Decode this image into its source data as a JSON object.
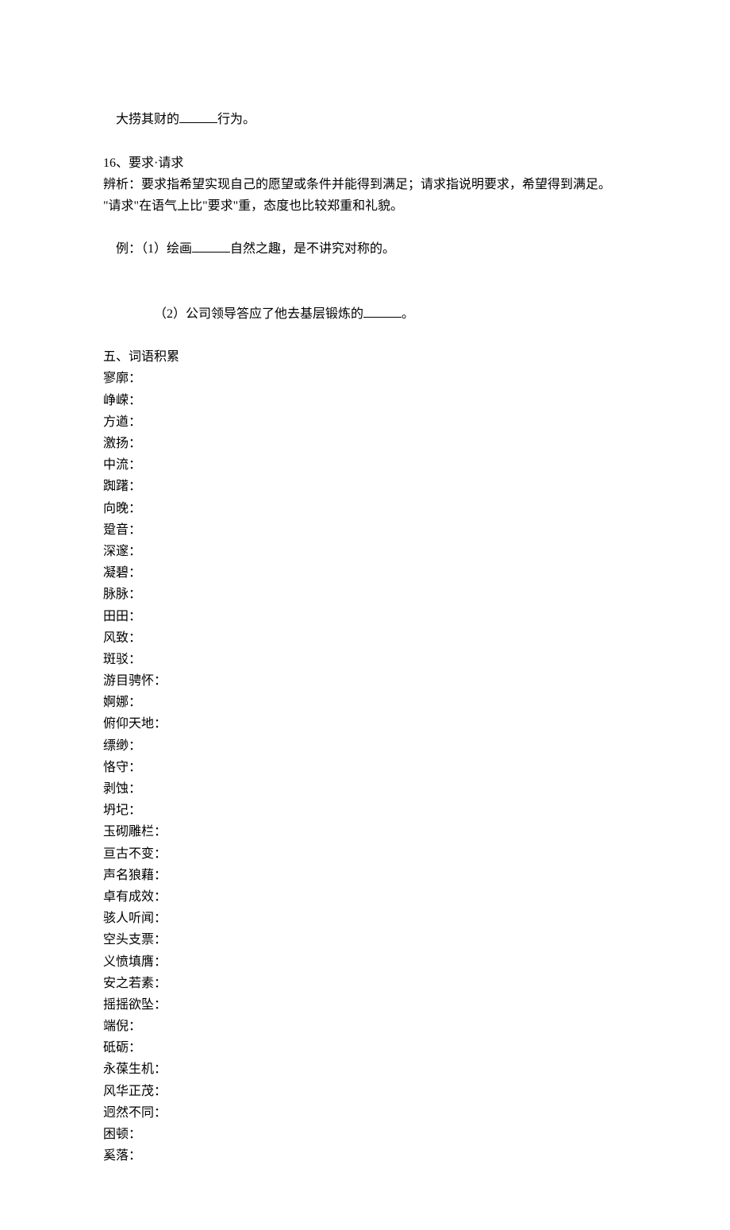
{
  "lines": {
    "l1a": "大捞其财的",
    "l1b": "行为。",
    "l2": "16、要求·请求",
    "l3": "辨析：要求指希望实现自己的愿望或条件并能得到满足；请求指说明要求，希望得到满足。",
    "l4": "\"请求\"在语气上比\"要求\"重，态度也比较郑重和礼貌。",
    "l5a": "例：（1）绘画",
    "l5b": "自然之趣，是不讲究对称的。",
    "l6a": "（2）公司领导答应了他去基层锻炼的",
    "l6b": "。",
    "l7": "五、词语积累",
    "vocab": [
      "寥廓：",
      "峥嵘：",
      "方遒：",
      "激扬：",
      "中流：",
      "踟躇：",
      "向晚：",
      "跫音：",
      "深邃：",
      "凝碧：",
      "脉脉：",
      "田田：",
      "风致：",
      "斑驳：",
      "游目骋怀：",
      "婀娜：",
      "俯仰天地：",
      "缥缈：",
      "恪守：",
      "剥蚀：",
      "坍圮：",
      "玉砌雕栏：",
      "亘古不变：",
      "声名狼藉：",
      "卓有成效：",
      "骇人听闻：",
      "空头支票：",
      "义愤填膺：",
      "安之若素：",
      "摇摇欲坠：",
      "端倪：",
      "砥砺：",
      "永葆生机：",
      "风华正茂：",
      "迥然不同：",
      "困顿：",
      "奚落："
    ]
  }
}
